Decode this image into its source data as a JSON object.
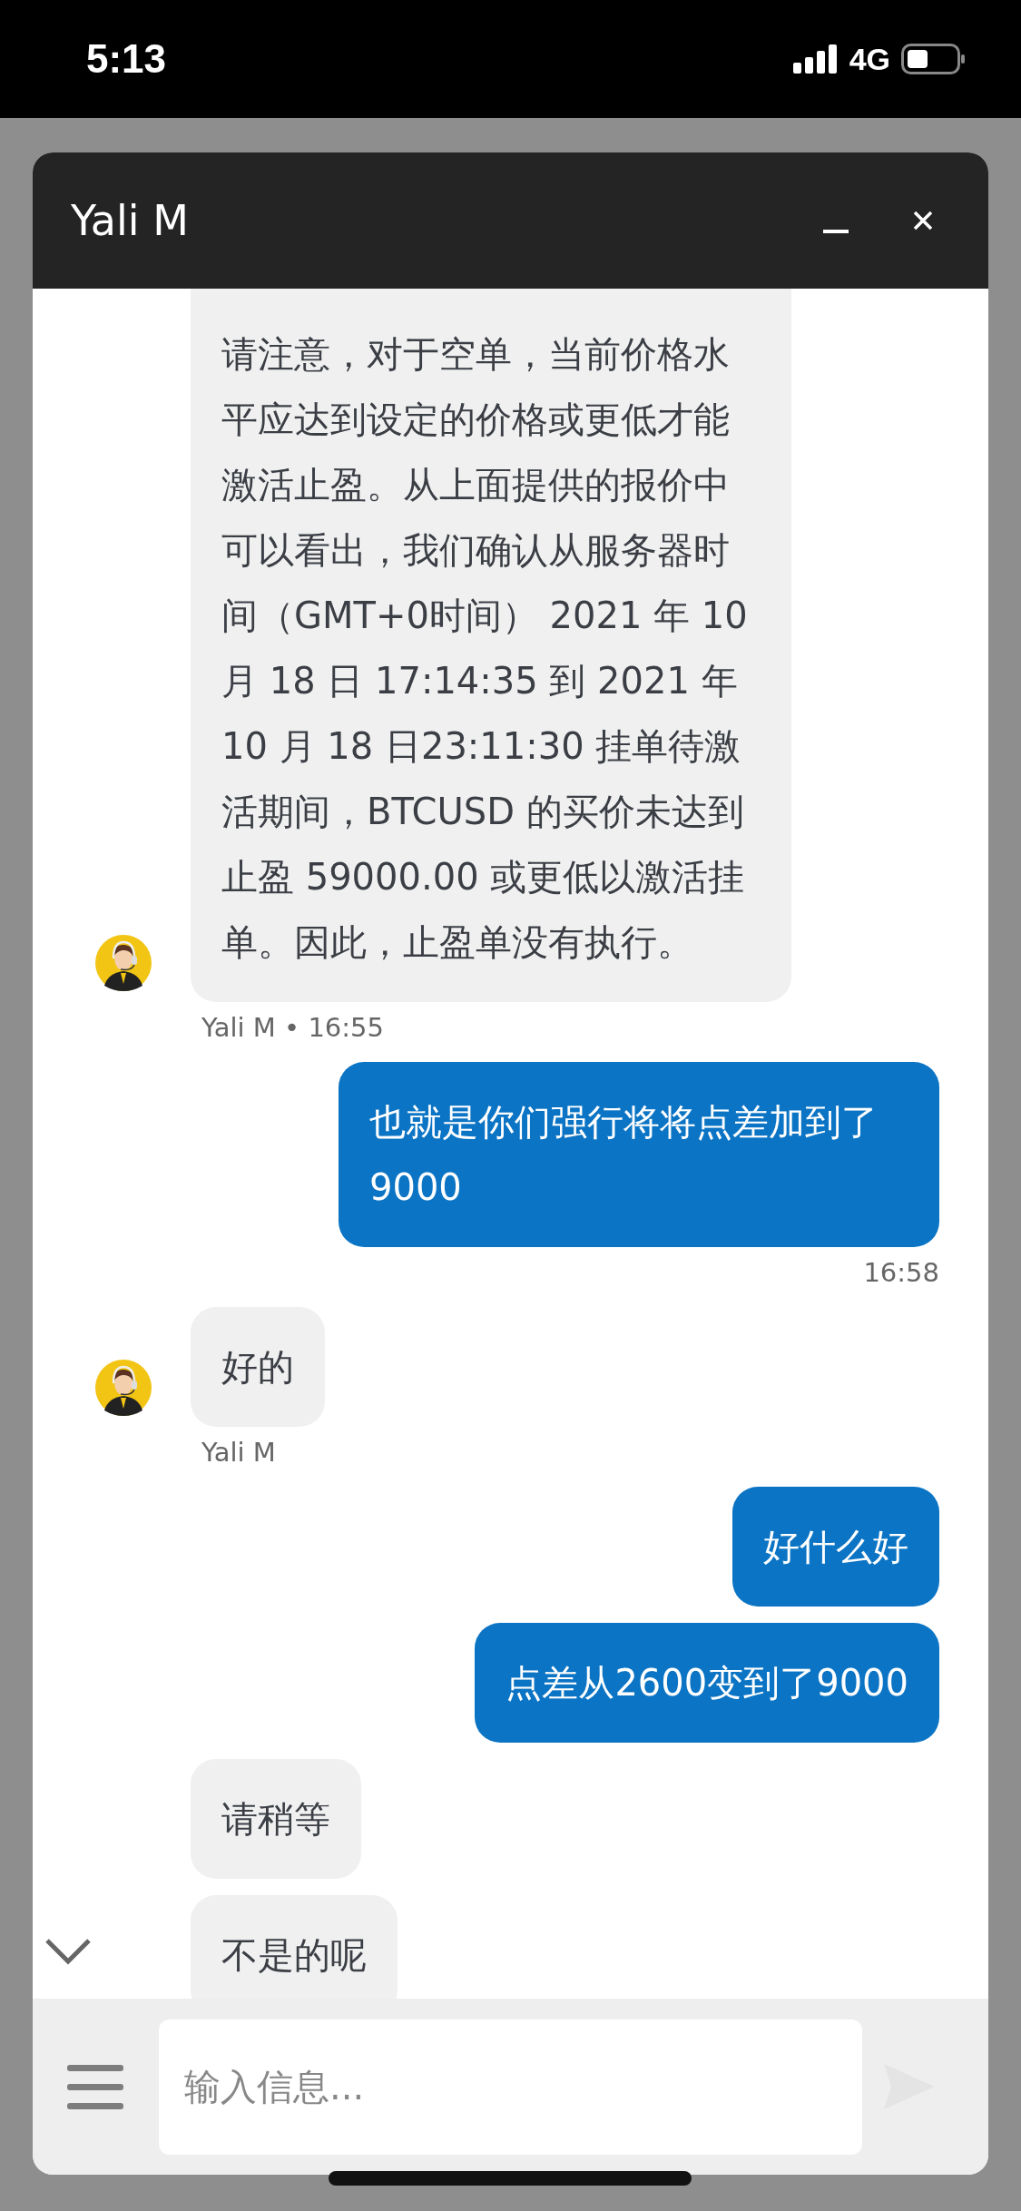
{
  "status_bar": {
    "time": "5:13",
    "network": "4G"
  },
  "chat": {
    "title": "Yali M",
    "messages": [
      {
        "kind": "agent",
        "avatar": true,
        "text": "请注意，对于空单，当前价格水平应达到设定的价格或更低才能激活止盈。从上面提供的报价中可以看出，我们确认从服务器时间（GMT+0时间） 2021 年 10 月 18 日 17:14:35 到 2021 年 10 月 18 日23:11:30  挂单待激活期间，BTCUSD 的买价未达到止盈 59000.00 或更低以激活挂单。因此，止盈单没有执行。",
        "meta": "Yali M • 16:55"
      },
      {
        "kind": "user",
        "text": "也就是你们强行将将点差加到了9000",
        "meta": "16:58"
      },
      {
        "kind": "agent",
        "avatar": true,
        "text": "好的",
        "meta": "Yali M"
      },
      {
        "kind": "user",
        "text": "好什么好"
      },
      {
        "kind": "user",
        "text": "点差从2600变到了9000"
      },
      {
        "kind": "agent",
        "avatar": false,
        "text": "请稍等"
      },
      {
        "kind": "agent",
        "avatar": false,
        "text": "不是的呢"
      }
    ]
  },
  "composer": {
    "placeholder": "输入信息..."
  }
}
